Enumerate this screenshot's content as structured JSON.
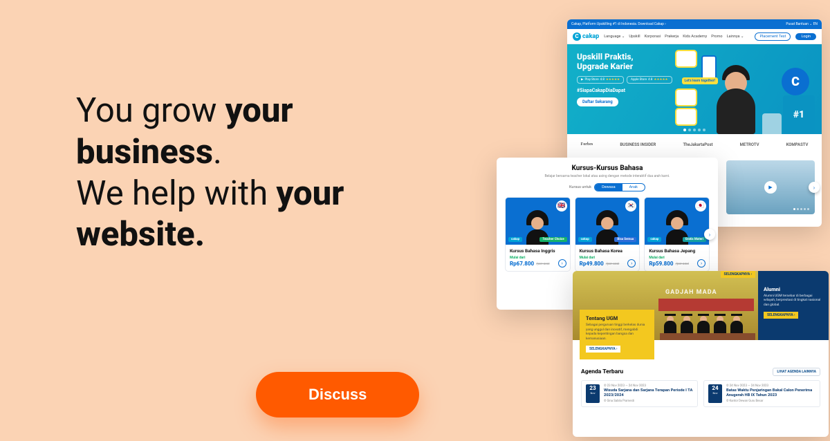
{
  "hero": {
    "line1_a": "You grow ",
    "line1_b": "your business",
    "line1_c": ".",
    "line2_a": "We help with ",
    "line2_b": "your website."
  },
  "cta_label": "Discuss",
  "shot1": {
    "top_bar_left": "Cakap, Platform Upskilling #1 di Indonesia.  Download Cakap ›",
    "top_bar_right": "Pusat Bantuan ⌄   EN",
    "brand": "cakap",
    "nav": [
      "Language ⌄",
      "Upskill",
      "Korporasi",
      "Prakerja",
      "Kids Academy",
      "Promo",
      "Lainnya ⌄"
    ],
    "placement_pill": "Placement Test",
    "login": "Login",
    "hero_title_1": "Upskill Praktis,",
    "hero_title_2": "Upgrade Karier",
    "store_play": "Play Store",
    "store_apple": "Apple Store",
    "rating_play": "4.8",
    "rating_apple": "4.8",
    "hashtag": "#SiapaCakapDiaDapat",
    "daftar": "Daftar Sekarang",
    "lets_learn": "Let's learn together!",
    "badge_c": "C",
    "badge_rank": "#1",
    "press": [
      "Forbes",
      "BUSINESS INSIDER",
      "TheJakartaPost",
      "METROTV",
      "KOMPASTV"
    ]
  },
  "shot2": {
    "title": "Kursus-Kursus Bahasa",
    "subtitle": "Belajar bersama teacher lokal atau asing dengan metode interaktif dua arah kami.",
    "toggle_label": "Kursus untuk",
    "seg_on": "Dewasa",
    "seg_off": "Anak",
    "cakap_tag": "cakap",
    "cards": [
      {
        "flag": "🇬🇧",
        "variant": "Teacher Choice",
        "variant_class": "s2-chip-green",
        "title": "Kursus Bahasa Inggris",
        "mulai": "Mulai dari",
        "price": "Rp67.800",
        "old": "/per sesi"
      },
      {
        "flag": "🇰🇷",
        "variant": "Bisa Semua",
        "variant_class": "s2-chip-blue",
        "title": "Kursus Bahasa Korea",
        "mulai": "Mulai dari",
        "price": "Rp49.800",
        "old": "/per sesi"
      },
      {
        "flag": "🇯🇵",
        "variant": "Gratis Materi",
        "variant_class": "s2-chip-teal",
        "title": "Kursus Bahasa Jepang",
        "mulai": "Mulai dari",
        "price": "Rp59.800",
        "old": "/per sesi"
      }
    ]
  },
  "shot3": {
    "tag": "SELENGKAPNYA ›",
    "yellow": {
      "title": "Tentang UGM",
      "body": "Sebagai perguruan tinggi berkelas dunia yang unggul dan inovatif, mengabdi kepada kepentingan bangsa dan kemanusiaan.",
      "btn": "SELENGKAPNYA ›"
    },
    "center_name": "GADJAH MADA",
    "blue": {
      "title": "Alumni",
      "body": "Alumni UGM tersebar di berbagai wilayah, berprestasi di tingkat nasional dan global.",
      "btn": "SELENGKAPNYA ›"
    },
    "agenda_heading": "Agenda Terbaru",
    "agenda_see_all": "LIHAT AGENDA LAINNYA",
    "agenda": [
      {
        "day": "23",
        "mon": "Nov",
        "range": "© 23 Nov 2023 — 24 Nov 2023",
        "title": "Wisuda Sarjana dan Sarjana Terapan Periode I TA 2023/2024",
        "author": "© Gina Sabila Pramesti"
      },
      {
        "day": "24",
        "mon": "Nov",
        "range": "© 24 Nov 2023 — 24 Nov 2023",
        "title": "Batas Waktu Penjaringan Bakal Calon Penerima Anugerah HB IX Tahun 2023",
        "author": "© Kantor Dewan Guru Besar"
      }
    ]
  }
}
